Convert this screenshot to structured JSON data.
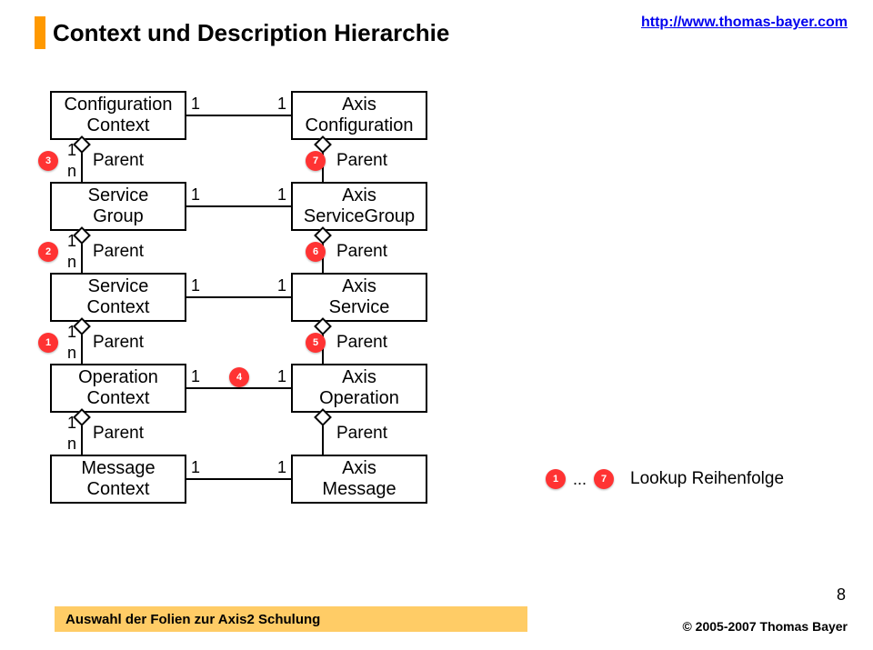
{
  "header": {
    "title": "Context und Description Hierarchie",
    "url": "http://www.thomas-bayer.com"
  },
  "left_boxes": {
    "b0": {
      "l1": "Configuration",
      "l2": "Context"
    },
    "b1": {
      "l1": "Service",
      "l2": "Group"
    },
    "b2": {
      "l1": "Service",
      "l2": "Context"
    },
    "b3": {
      "l1": "Operation",
      "l2": "Context"
    },
    "b4": {
      "l1": "Message",
      "l2": "Context"
    }
  },
  "right_boxes": {
    "b0": {
      "l1": "Axis",
      "l2": "Configuration"
    },
    "b1": {
      "l1": "Axis",
      "l2": "ServiceGroup"
    },
    "b2": {
      "l1": "Axis",
      "l2": "Service"
    },
    "b3": {
      "l1": "Axis",
      "l2": "Operation"
    },
    "b4": {
      "l1": "Axis",
      "l2": "Message"
    }
  },
  "labels": {
    "parent": "Parent",
    "one": "1",
    "n": "n",
    "dots": "..."
  },
  "circles": {
    "c1": "1",
    "c2": "2",
    "c3": "3",
    "c4": "4",
    "c5": "5",
    "c6": "6",
    "c7": "7"
  },
  "lookup": {
    "from": "1",
    "to": "7",
    "label": "Lookup Reihenfolge"
  },
  "footer": {
    "subtitle": "Auswahl der Folien zur Axis2 Schulung",
    "copyright": "© 2005-2007 Thomas Bayer",
    "page": "8"
  }
}
